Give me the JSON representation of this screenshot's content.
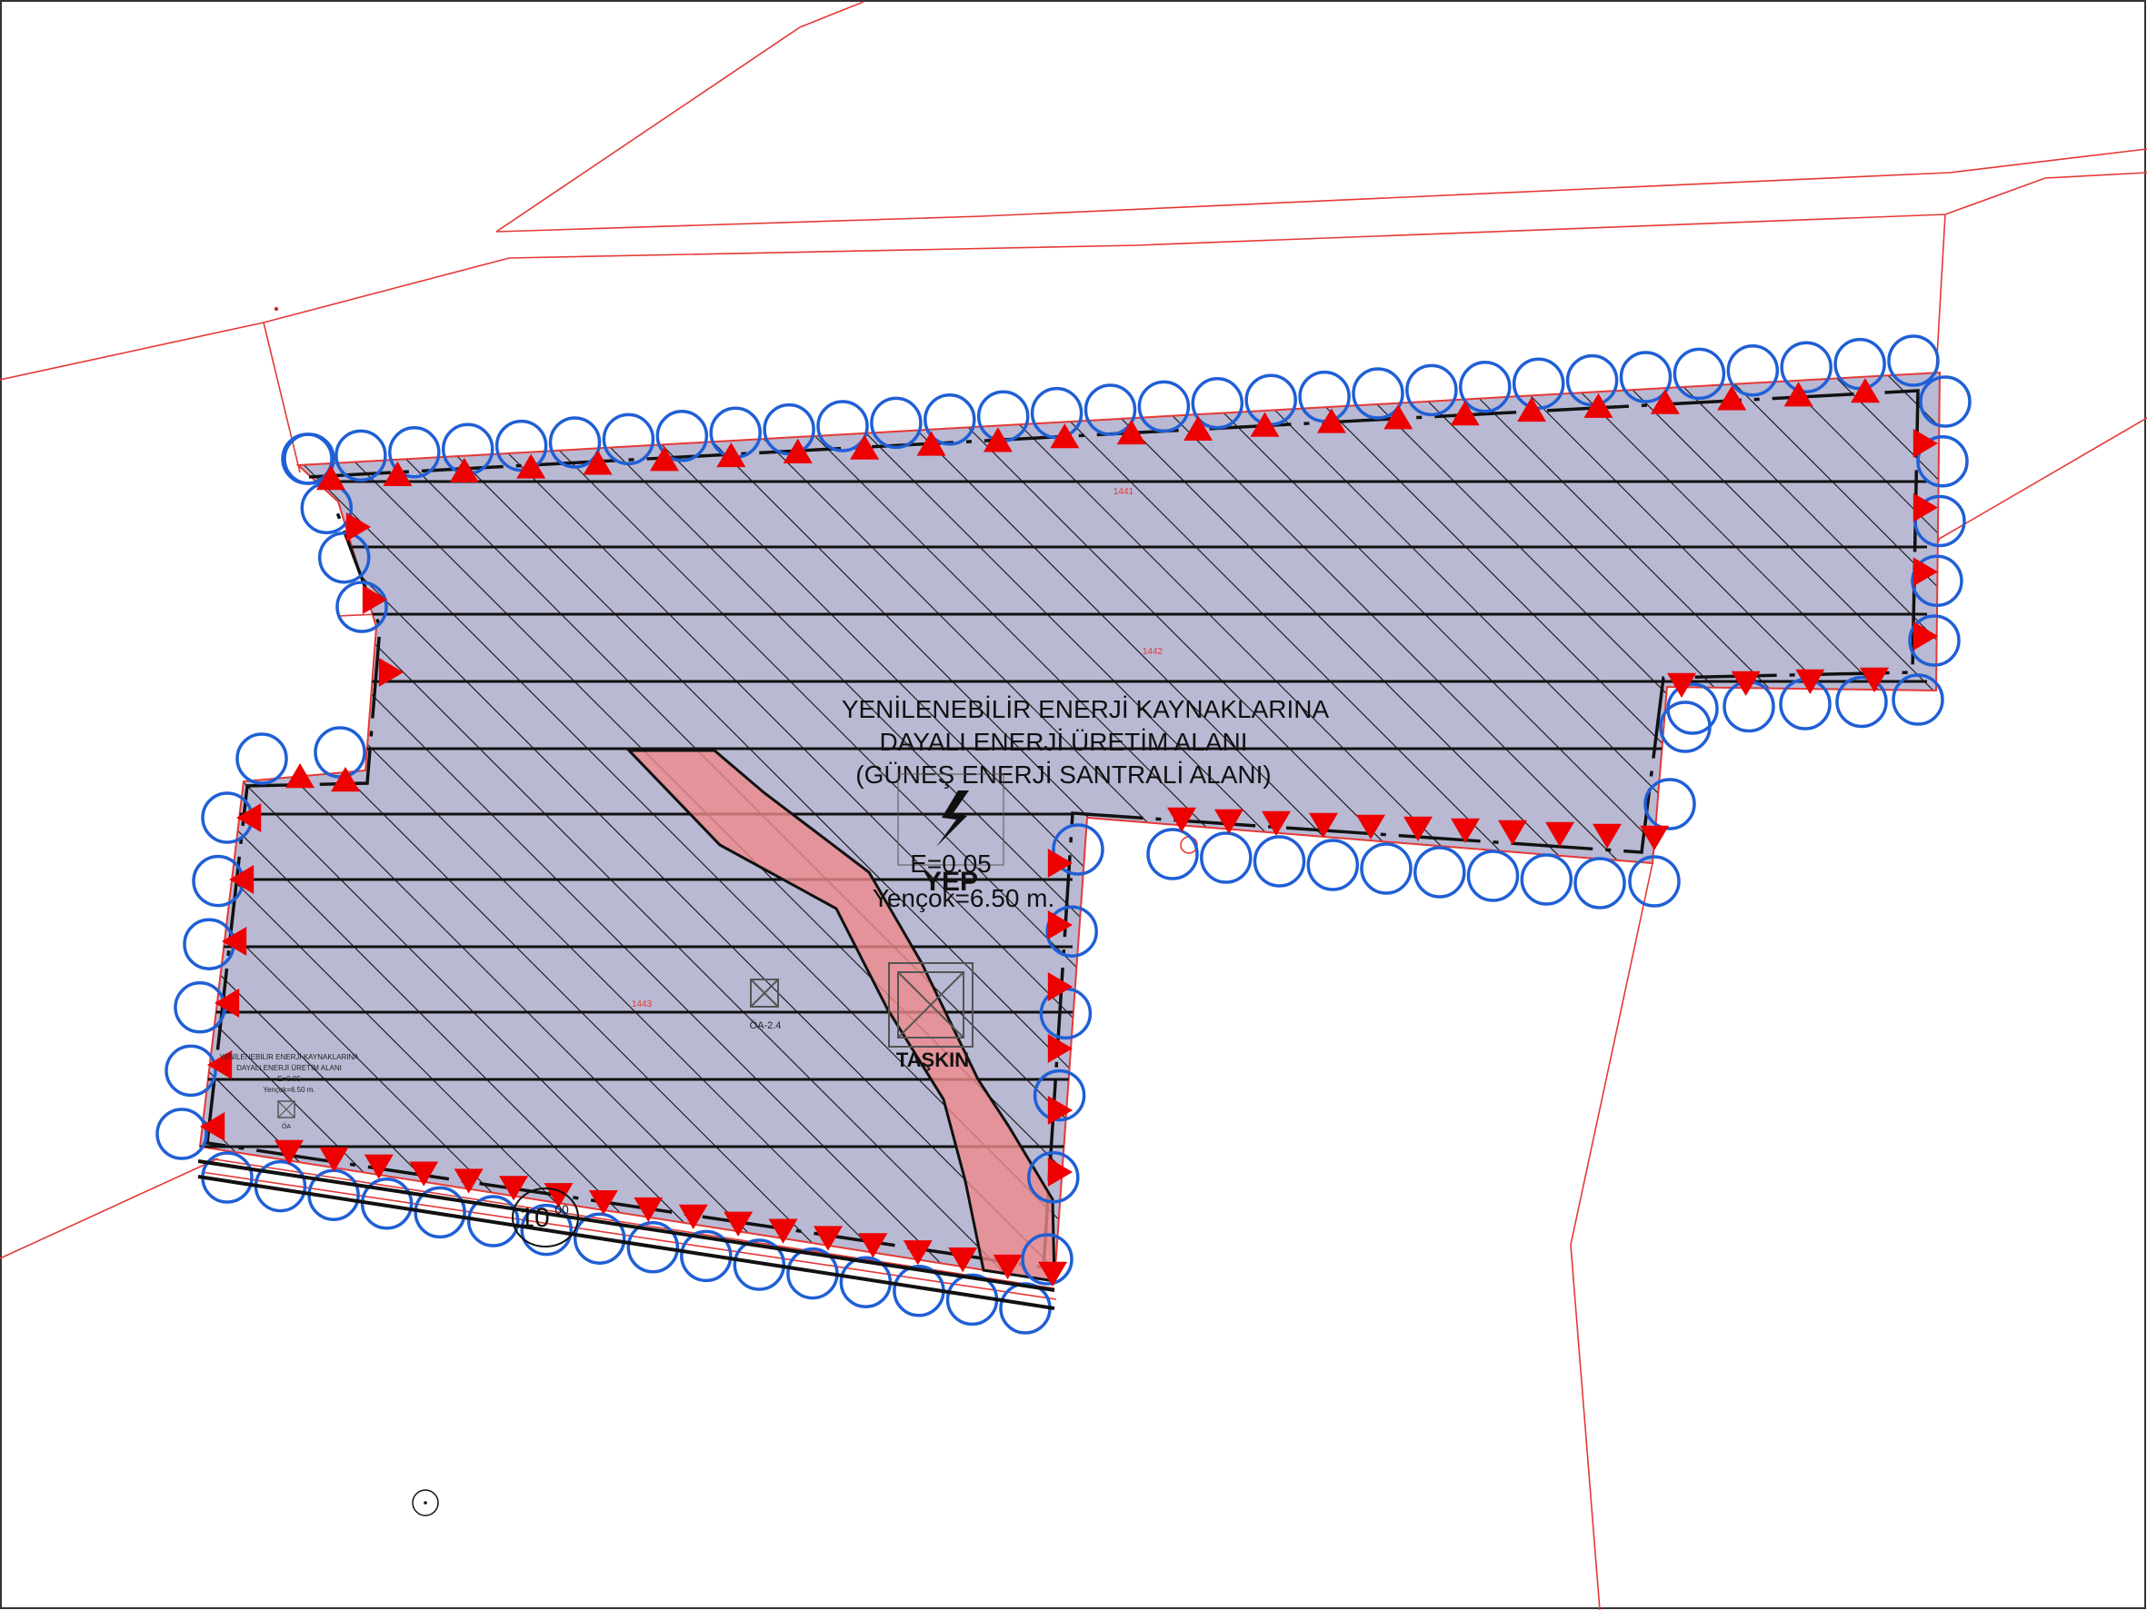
{
  "colors": {
    "parcel_line": "#e53935",
    "boundary_line": "#111111",
    "area_fill": "#b9b9d4",
    "hatch": "#111111",
    "flood_fill": "#ee8a8a",
    "circle_marker": "#1f5fd6",
    "arrow_marker": "#ee0000"
  },
  "zone_label": {
    "line1": "YENİLENEBİLİR ENERJİ KAYNAKLARINA",
    "line2": "DAYALI ENERJİ ÜRETİM ALANI",
    "line3": "(GÜNEŞ ENERJİ SANTRALİ ALANI)"
  },
  "energy_symbol": "lightning-bolt-icon",
  "density_text": "E=0.05",
  "zone_code": "YEP",
  "height_text": "Yençok=6.50 m.",
  "flood_label": "TAŞKIN",
  "parcel_numbers": [
    "1441",
    "1442",
    "1443"
  ],
  "note_small": "ÖA-2.4",
  "setback_value": "10",
  "setback_superscript": "00",
  "legend_block": {
    "line1": "YENİLENEBİLİR ENERJİ KAYNAKLARINA",
    "line2": "DAYALI ENERJİ ÜRETİM ALANI",
    "line3": "E=0.05",
    "line4": "Yençok=6.50 m.",
    "code": "ÖA"
  }
}
